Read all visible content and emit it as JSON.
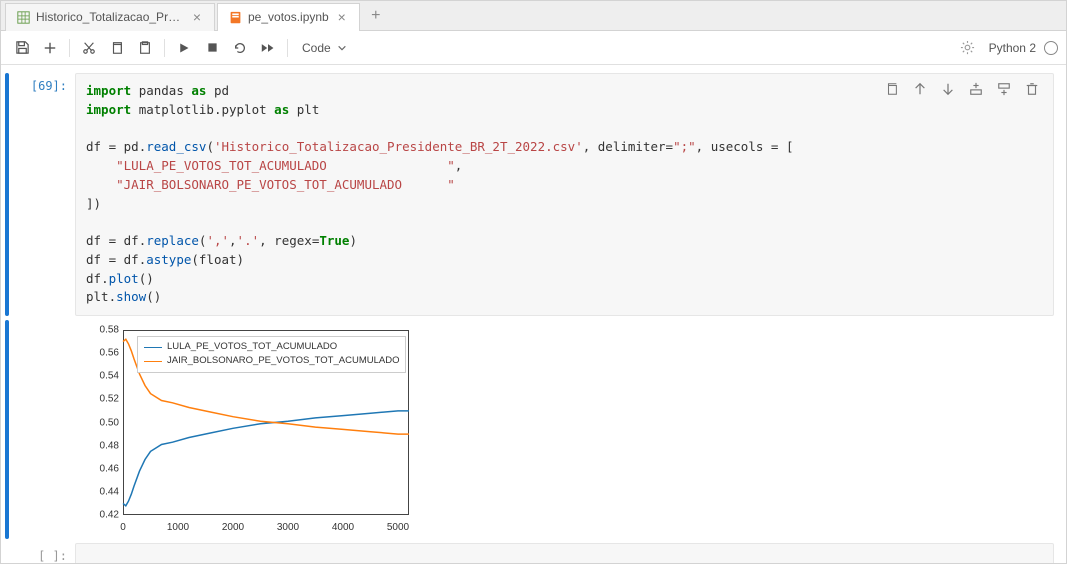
{
  "tabs": [
    {
      "label": "Historico_Totalizacao_Preside",
      "icon": "spreadsheet",
      "active": false
    },
    {
      "label": "pe_votos.ipynb",
      "icon": "notebook",
      "active": true
    }
  ],
  "toolbar": {
    "cell_type": "Code",
    "kernel": "Python 2"
  },
  "cell": {
    "prompt_in": "[69]:",
    "prompt_empty": "[ ]:",
    "code_tokens": [
      {
        "t": "kw",
        "v": "import"
      },
      {
        "t": "sp",
        "v": " "
      },
      {
        "t": "nm",
        "v": "pandas"
      },
      {
        "t": "sp",
        "v": " "
      },
      {
        "t": "kw",
        "v": "as"
      },
      {
        "t": "sp",
        "v": " "
      },
      {
        "t": "nm",
        "v": "pd"
      },
      {
        "t": "nl"
      },
      {
        "t": "kw",
        "v": "import"
      },
      {
        "t": "sp",
        "v": " "
      },
      {
        "t": "nm",
        "v": "matplotlib"
      },
      {
        "t": "nm",
        "v": "."
      },
      {
        "t": "nm",
        "v": "pyplot"
      },
      {
        "t": "sp",
        "v": " "
      },
      {
        "t": "kw",
        "v": "as"
      },
      {
        "t": "sp",
        "v": " "
      },
      {
        "t": "nm",
        "v": "plt"
      },
      {
        "t": "nl"
      },
      {
        "t": "nl"
      },
      {
        "t": "nm",
        "v": "df "
      },
      {
        "t": "nm",
        "v": "="
      },
      {
        "t": "nm",
        "v": " pd"
      },
      {
        "t": "nm",
        "v": "."
      },
      {
        "t": "fn",
        "v": "read_csv"
      },
      {
        "t": "nm",
        "v": "("
      },
      {
        "t": "str",
        "v": "'Historico_Totalizacao_Presidente_BR_2T_2022.csv'"
      },
      {
        "t": "nm",
        "v": ", delimiter"
      },
      {
        "t": "nm",
        "v": "="
      },
      {
        "t": "str",
        "v": "\";\""
      },
      {
        "t": "nm",
        "v": ", usecols "
      },
      {
        "t": "nm",
        "v": "="
      },
      {
        "t": "nm",
        "v": " ["
      },
      {
        "t": "nl"
      },
      {
        "t": "nm",
        "v": "    "
      },
      {
        "t": "str",
        "v": "\"LULA_PE_VOTOS_TOT_ACUMULADO                \""
      },
      {
        "t": "nm",
        "v": ","
      },
      {
        "t": "nl"
      },
      {
        "t": "nm",
        "v": "    "
      },
      {
        "t": "str",
        "v": "\"JAIR_BOLSONARO_PE_VOTOS_TOT_ACUMULADO      \""
      },
      {
        "t": "nl"
      },
      {
        "t": "nm",
        "v": "])"
      },
      {
        "t": "nl"
      },
      {
        "t": "nl"
      },
      {
        "t": "nm",
        "v": "df "
      },
      {
        "t": "nm",
        "v": "="
      },
      {
        "t": "nm",
        "v": " df"
      },
      {
        "t": "nm",
        "v": "."
      },
      {
        "t": "fn",
        "v": "replace"
      },
      {
        "t": "nm",
        "v": "("
      },
      {
        "t": "str",
        "v": "','"
      },
      {
        "t": "nm",
        "v": ","
      },
      {
        "t": "str",
        "v": "'.'"
      },
      {
        "t": "nm",
        "v": ", regex"
      },
      {
        "t": "nm",
        "v": "="
      },
      {
        "t": "bool",
        "v": "True"
      },
      {
        "t": "nm",
        "v": ")"
      },
      {
        "t": "nl"
      },
      {
        "t": "nm",
        "v": "df "
      },
      {
        "t": "nm",
        "v": "="
      },
      {
        "t": "nm",
        "v": " df"
      },
      {
        "t": "nm",
        "v": "."
      },
      {
        "t": "fn",
        "v": "astype"
      },
      {
        "t": "nm",
        "v": "(float)"
      },
      {
        "t": "nl"
      },
      {
        "t": "nm",
        "v": "df"
      },
      {
        "t": "nm",
        "v": "."
      },
      {
        "t": "fn",
        "v": "plot"
      },
      {
        "t": "nm",
        "v": "()"
      },
      {
        "t": "nl"
      },
      {
        "t": "nm",
        "v": "plt"
      },
      {
        "t": "nm",
        "v": "."
      },
      {
        "t": "fn",
        "v": "show"
      },
      {
        "t": "nm",
        "v": "()"
      }
    ]
  },
  "chart_data": {
    "type": "line",
    "xlabel": "",
    "ylabel": "",
    "xlim": [
      0,
      5200
    ],
    "ylim": [
      0.42,
      0.58
    ],
    "xticks": [
      0,
      1000,
      2000,
      3000,
      4000,
      5000
    ],
    "yticks": [
      0.42,
      0.44,
      0.46,
      0.48,
      0.5,
      0.52,
      0.54,
      0.56,
      0.58
    ],
    "series": [
      {
        "name": "LULA_PE_VOTOS_TOT_ACUMULADO",
        "color": "#1f77b4",
        "data": [
          [
            0,
            0.43
          ],
          [
            50,
            0.428
          ],
          [
            100,
            0.432
          ],
          [
            150,
            0.438
          ],
          [
            200,
            0.445
          ],
          [
            300,
            0.458
          ],
          [
            400,
            0.468
          ],
          [
            500,
            0.475
          ],
          [
            700,
            0.481
          ],
          [
            900,
            0.483
          ],
          [
            1200,
            0.487
          ],
          [
            1600,
            0.491
          ],
          [
            2000,
            0.495
          ],
          [
            2500,
            0.499
          ],
          [
            3000,
            0.501
          ],
          [
            3500,
            0.504
          ],
          [
            4000,
            0.506
          ],
          [
            4500,
            0.508
          ],
          [
            5000,
            0.51
          ],
          [
            5200,
            0.51
          ]
        ]
      },
      {
        "name": "JAIR_BOLSONARO_PE_VOTOS_TOT_ACUMULADO",
        "color": "#ff7f0e",
        "data": [
          [
            0,
            0.57
          ],
          [
            50,
            0.572
          ],
          [
            100,
            0.568
          ],
          [
            150,
            0.562
          ],
          [
            200,
            0.555
          ],
          [
            300,
            0.542
          ],
          [
            400,
            0.532
          ],
          [
            500,
            0.525
          ],
          [
            700,
            0.519
          ],
          [
            900,
            0.517
          ],
          [
            1200,
            0.513
          ],
          [
            1600,
            0.509
          ],
          [
            2000,
            0.505
          ],
          [
            2500,
            0.501
          ],
          [
            3000,
            0.499
          ],
          [
            3500,
            0.496
          ],
          [
            4000,
            0.494
          ],
          [
            4500,
            0.492
          ],
          [
            5000,
            0.49
          ],
          [
            5200,
            0.49
          ]
        ]
      }
    ]
  }
}
